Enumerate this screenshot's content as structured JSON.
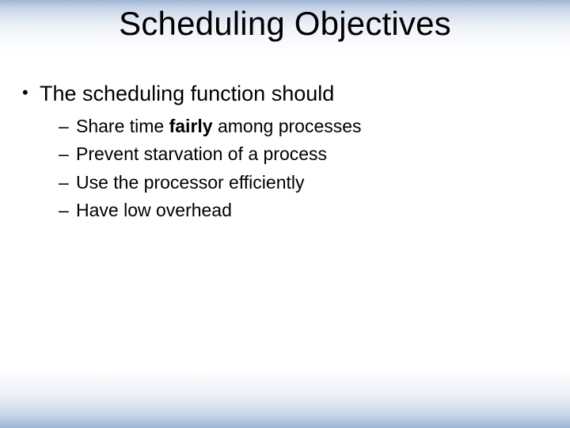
{
  "title": "Scheduling Objectives",
  "bullet1": "The scheduling function should",
  "sub1_pre": "Share time ",
  "sub1_bold": "fairly",
  "sub1_post": " among processes",
  "sub2": "Prevent starvation of a process",
  "sub3": "Use the processor efficiently",
  "sub4": "Have low overhead"
}
